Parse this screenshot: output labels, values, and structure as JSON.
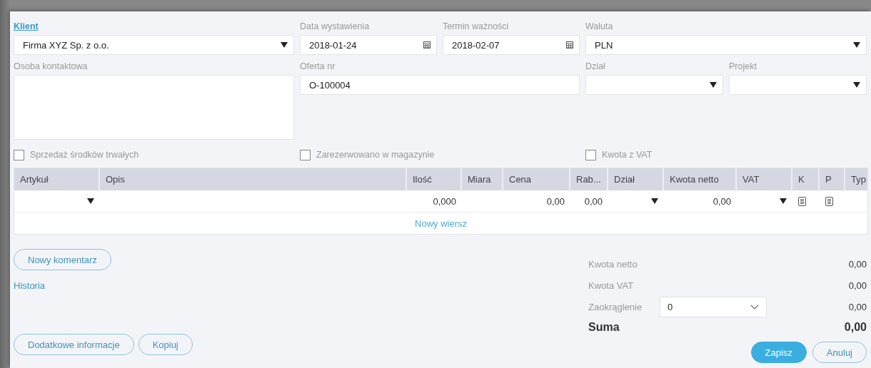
{
  "client": {
    "label": "Klient",
    "value": "Firma XYZ Sp. z o.o."
  },
  "issue_date": {
    "label": "Data wystawienia",
    "value": "2018-01-24"
  },
  "valid_until": {
    "label": "Termin ważności",
    "value": "2018-02-07"
  },
  "currency": {
    "label": "Waluta",
    "value": "PLN"
  },
  "contact": {
    "label": "Osoba kontaktowa"
  },
  "offer_number": {
    "label": "Oferta nr",
    "value": "O-100004"
  },
  "department": {
    "label": "Dział"
  },
  "project": {
    "label": "Projekt"
  },
  "checkboxes": [
    {
      "label": "Sprzedaż środków trwałych",
      "checked": false
    },
    {
      "label": "Zarezerwowano w magazynie",
      "checked": false
    },
    {
      "label": "Kwota z VAT",
      "checked": false
    }
  ],
  "table": {
    "columns": [
      "Artykuł",
      "Opis",
      "Ilość",
      "Miara",
      "Cena",
      "Rab...",
      "Dział",
      "Kwota netto",
      "VAT",
      "K",
      "P",
      "Typ"
    ],
    "rows": [
      {
        "cells": [
          {
            "kind": "select"
          },
          {
            "kind": "blank"
          },
          {
            "kind": "number",
            "value": "0,000"
          },
          {
            "kind": "blank"
          },
          {
            "kind": "number",
            "value": "0,00"
          },
          {
            "kind": "number",
            "value": "0,00"
          },
          {
            "kind": "select"
          },
          {
            "kind": "number",
            "value": "0,00"
          },
          {
            "kind": "select"
          },
          {
            "kind": "doc"
          },
          {
            "kind": "doc"
          },
          {
            "kind": "blank"
          }
        ]
      }
    ],
    "new_row": "Nowy wiersz"
  },
  "comment_button": "Nowy komentarz",
  "history_link": "Historia",
  "summary": [
    {
      "kind": "plain",
      "label": "Kwota netto",
      "value": "0,00"
    },
    {
      "kind": "plain",
      "label": "Kwota VAT",
      "value": "0,00"
    },
    {
      "kind": "rounding",
      "label": "Zaokrąglenie",
      "select": "0",
      "value": "0,00"
    },
    {
      "kind": "total",
      "label": "Suma",
      "value": "0,00"
    }
  ],
  "footer_left": [
    {
      "label": "Dodatkowe informacje",
      "kind": "outline"
    },
    {
      "label": "Kopiuj",
      "kind": "outline"
    }
  ],
  "footer_right": [
    {
      "label": "Zapisz",
      "kind": "primary"
    },
    {
      "label": "Anuluj",
      "kind": "outline"
    }
  ]
}
